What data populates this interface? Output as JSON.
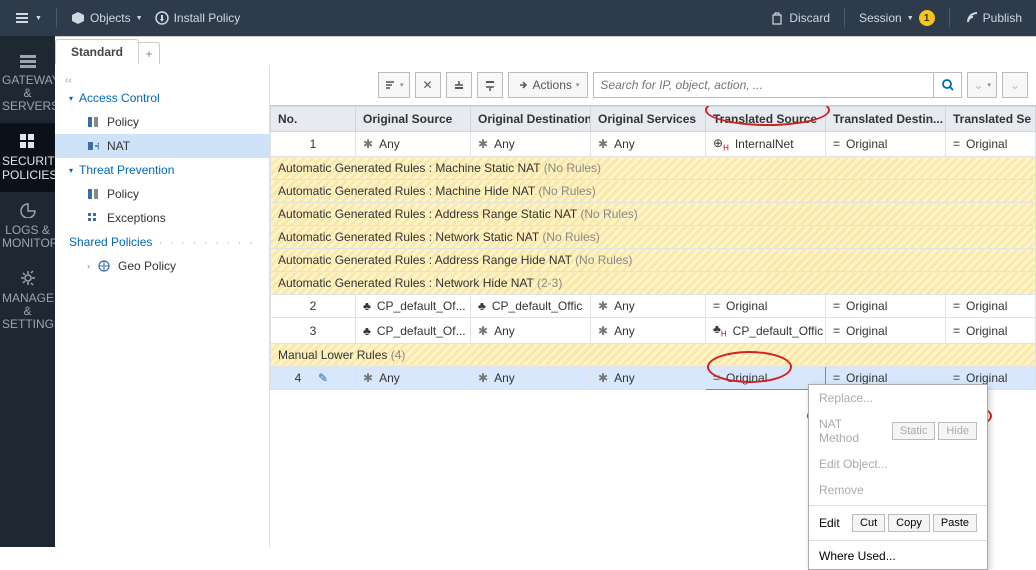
{
  "topbar": {
    "objects": "Objects",
    "install": "Install Policy",
    "discard": "Discard",
    "session": "Session",
    "session_badge": "1",
    "publish": "Publish"
  },
  "rail": [
    {
      "label": "GATEWAYS & SERVERS"
    },
    {
      "label": "SECURITY POLICIES"
    },
    {
      "label": "LOGS & MONITOR"
    },
    {
      "label": "MANAGE & SETTINGS"
    }
  ],
  "tab": {
    "name": "Standard",
    "add": "+"
  },
  "nav": {
    "collapse": "‹‹",
    "access": "Access Control",
    "policy": "Policy",
    "nat": "NAT",
    "threat": "Threat Prevention",
    "tp_policy": "Policy",
    "tp_exc": "Exceptions",
    "shared": "Shared Policies",
    "geo": "Geo Policy"
  },
  "toolbar": {
    "actions": "Actions",
    "search_ph": "Search for IP, object, action, ..."
  },
  "headers": [
    "No.",
    "Original Source",
    "Original Destination",
    "Original Services",
    "Translated Source",
    "Translated Destin...",
    "Translated Se"
  ],
  "rows": {
    "r1": {
      "no": "1",
      "v": "Any",
      "ts": "InternalNet",
      "o": "Original"
    },
    "sec1": "Automatic Generated Rules : Machine Static NAT",
    "nr": "(No Rules)",
    "sec2": "Automatic Generated Rules : Machine Hide NAT",
    "sec3": "Automatic Generated Rules : Address Range Static NAT",
    "sec4": "Automatic Generated Rules : Network Static NAT",
    "sec5": "Automatic Generated Rules : Address Range Hide NAT",
    "sec6": "Automatic Generated Rules : Network Hide NAT",
    "sec6n": "(2-3)",
    "r2": {
      "no": "2",
      "cp": "CP_default_Of...",
      "cp2": "CP_default_Offic",
      "v": "Any",
      "o": "Original"
    },
    "r3": {
      "no": "3",
      "cp": "CP_default_Of...",
      "v": "Any",
      "ts": "CP_default_Offic",
      "o": "Original"
    },
    "sec7": "Manual Lower Rules",
    "sec7n": "(4)",
    "r4": {
      "no": "4",
      "v": "Any",
      "o": "Original"
    }
  },
  "menu": {
    "replace": "Replace...",
    "natmethod": "NAT Method",
    "static": "Static",
    "hide": "Hide",
    "editobj": "Edit Object...",
    "remove": "Remove",
    "edit": "Edit",
    "cut": "Cut",
    "copy": "Copy",
    "paste": "Paste",
    "where": "Where Used..."
  }
}
